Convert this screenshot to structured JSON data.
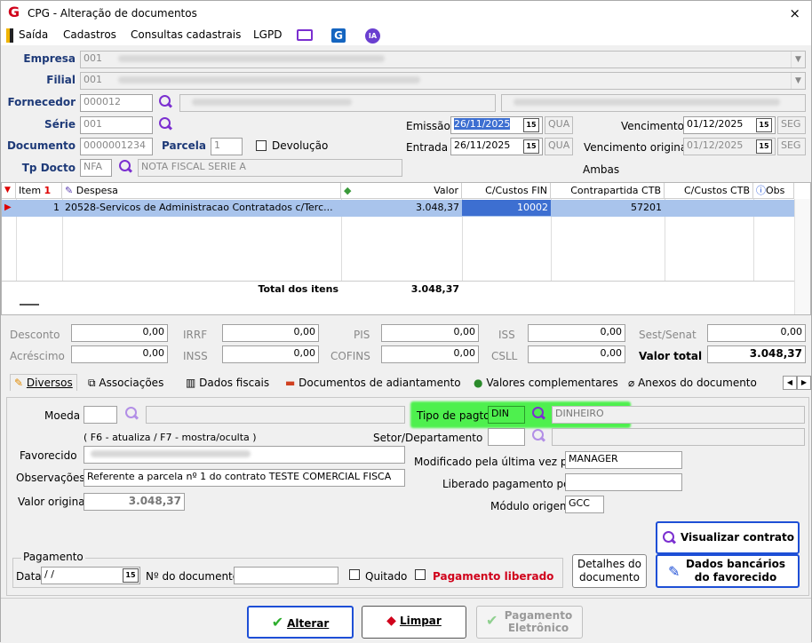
{
  "window": {
    "title": "CPG - Alteração de documentos",
    "close": "×"
  },
  "menu": {
    "saida": "Saída",
    "cadastros": "Cadastros",
    "consultas": "Consultas cadastrais",
    "lgpd": "LGPD",
    "ia": "IA",
    "g": "G"
  },
  "header": {
    "empresa_label": "Empresa",
    "empresa_code": "001",
    "filial_label": "Filial",
    "filial_code": "001",
    "fornecedor_label": "Fornecedor",
    "fornecedor_code": "000012",
    "serie_label": "Série",
    "serie_value": "001",
    "documento_label": "Documento",
    "documento_value": "0000001234",
    "parcela_label": "Parcela",
    "parcela_value": "1",
    "devolucao_label": "Devolução",
    "tpdocto_label": "Tp Docto",
    "tpdocto_code": "NFA",
    "tpdocto_desc": "NOTA FISCAL SERIE A",
    "emissao_label": "Emissão",
    "emissao_value": "26/11/2025",
    "emissao_day": "QUA",
    "entrada_label": "Entrada",
    "entrada_value": "26/11/2025",
    "entrada_day": "QUA",
    "vencimento_label": "Vencimento",
    "vencimento_value": "01/12/2025",
    "vencimento_day": "SEG",
    "venc_orig_label": "Vencimento original",
    "venc_orig_value": "01/12/2025",
    "venc_orig_day": "SEG",
    "ambas": "Ambas",
    "cal_icon": "15"
  },
  "grid": {
    "headers": {
      "item": "Item",
      "despesa": "Despesa",
      "valor": "Valor",
      "ccfin": "C/Custos FIN",
      "contra": "Contrapartida CTB",
      "ccctb": "C/Custos CTB",
      "obs": "Obs"
    },
    "rows": [
      {
        "item": "1",
        "despesa": "20528-Servicos de Administracao Contratados c/Terc...",
        "valor": "3.048,37",
        "ccfin": "10002",
        "contra": "57201",
        "ccctb": ""
      }
    ],
    "total_label": "Total dos itens",
    "total_value": "3.048,37"
  },
  "totals": {
    "desconto_label": "Desconto",
    "desconto": "0,00",
    "irrf_label": "IRRF",
    "irrf": "0,00",
    "pis_label": "PIS",
    "pis": "0,00",
    "iss_label": "ISS",
    "iss": "0,00",
    "sest_label": "Sest/Senat",
    "sest": "0,00",
    "acrescimo_label": "Acréscimo",
    "acrescimo": "0,00",
    "inss_label": "INSS",
    "inss": "0,00",
    "cofins_label": "COFINS",
    "cofins": "0,00",
    "csll_label": "CSLL",
    "csll": "0,00",
    "valor_total_label": "Valor total",
    "valor_total": "3.048,37"
  },
  "tabs": [
    "Diversos",
    "Associações",
    "Dados fiscais",
    "Documentos de adiantamento",
    "Valores complementares",
    "Anexos do documento"
  ],
  "diversos": {
    "moeda_label": "Moeda",
    "tipo_pagto_label": "Tipo de pagto",
    "tipo_pagto_code": "DIN",
    "tipo_pagto_desc": "DINHEIRO",
    "hint": "( F6 - atualiza / F7 - mostra/oculta )",
    "setor_label": "Setor/Departamento",
    "favorecido_label": "Favorecido",
    "modificado_label": "Modificado pela última vez por",
    "modificado_value": "MANAGER",
    "observacoes_label": "Observações",
    "observacoes_value": "Referente a parcela nº 1 do contrato TESTE COMERCIAL FISCA",
    "liberado_label": "Liberado pagamento por",
    "valor_original_label": "Valor original",
    "valor_original": "3.048,37",
    "modulo_label": "Módulo origem",
    "modulo_value": "GCC",
    "visualizar_btn": "Visualizar contrato",
    "pagamento_legend": "Pagamento",
    "data_label": "Data",
    "data_value": " / /",
    "ndoc_label": "Nº do documento",
    "quitado_label": "Quitado",
    "pag_liberado_label": "Pagamento liberado",
    "detalhes_btn_1": "Detalhes do",
    "detalhes_btn_2": "documento",
    "dados_bancarios_1": "Dados bancários",
    "dados_bancarios_2": "do favorecido"
  },
  "actions": {
    "alterar": "Alterar",
    "limpar": "Limpar",
    "pag_eletronico_1": "Pagamento",
    "pag_eletronico_2": "Eletrônico"
  }
}
